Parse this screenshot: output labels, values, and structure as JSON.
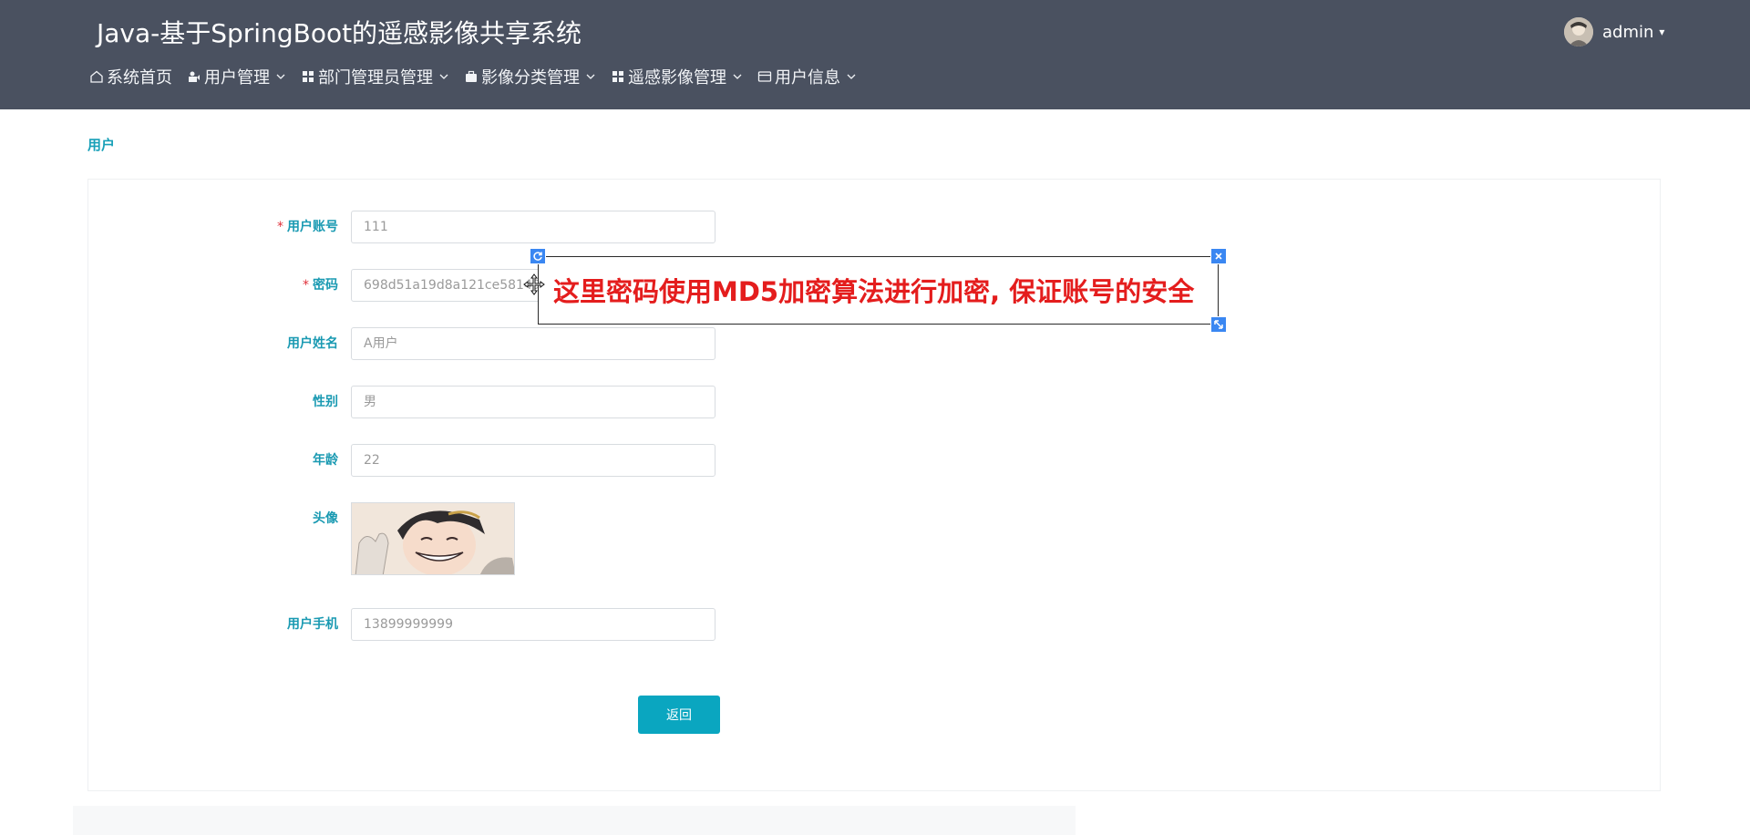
{
  "header": {
    "app_title": "Java-基于SpringBoot的遥感影像共享系统",
    "user": {
      "name": "admin",
      "avatar_icon": "avatar-image",
      "caret_icon": "caret-down-icon"
    },
    "nav": [
      {
        "label": "系统首页",
        "icon": "home-icon",
        "has_dropdown": false
      },
      {
        "label": "用户管理",
        "icon": "user-icon",
        "has_dropdown": true
      },
      {
        "label": "部门管理员管理",
        "icon": "grid-icon",
        "has_dropdown": true
      },
      {
        "label": "影像分类管理",
        "icon": "briefcase-icon",
        "has_dropdown": true
      },
      {
        "label": "遥感影像管理",
        "icon": "grid-icon",
        "has_dropdown": true
      },
      {
        "label": "用户信息",
        "icon": "card-icon",
        "has_dropdown": true
      }
    ]
  },
  "breadcrumb": "用户",
  "form": {
    "fields": [
      {
        "label": "用户账号",
        "required": true,
        "value": "111"
      },
      {
        "label": "密码",
        "required": true,
        "value": "698d51a19d8a121ce581499d7b701668"
      },
      {
        "label": "用户姓名",
        "required": false,
        "value": "A用户"
      },
      {
        "label": "性别",
        "required": false,
        "value": "男"
      },
      {
        "label": "年龄",
        "required": false,
        "value": "22"
      },
      {
        "label": "头像",
        "required": false,
        "value": ""
      },
      {
        "label": "用户手机",
        "required": false,
        "value": "13899999999"
      }
    ],
    "required_mark": "*",
    "back_button": "返回"
  },
  "annotation": {
    "text": "这里密码使用MD5加密算法进行加密, 保证账号的安全",
    "text_color": "#e41d1d",
    "handle_color": "#3a87f2"
  },
  "colors": {
    "header_bg": "#4a5160",
    "accent": "#18a0b8",
    "button_bg": "#0aa6c0",
    "required": "#e0303a"
  }
}
